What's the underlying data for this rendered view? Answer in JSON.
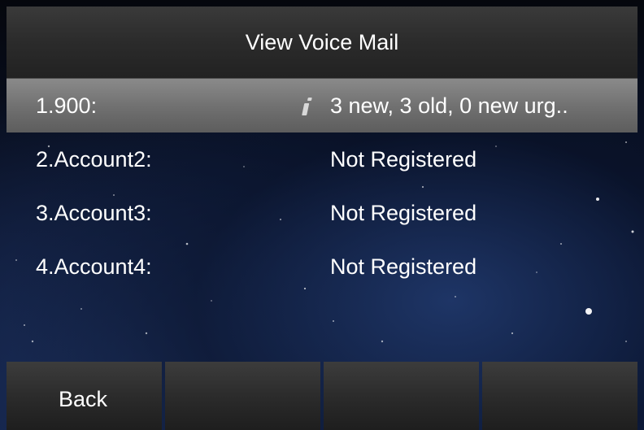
{
  "header": {
    "title": "View Voice Mail"
  },
  "accounts": [
    {
      "label": "1.900:",
      "status": "3 new, 3 old, 0 new urg..",
      "info_icon": "info-icon"
    },
    {
      "label": "2.Account2:",
      "status": "Not Registered"
    },
    {
      "label": "3.Account3:",
      "status": "Not Registered"
    },
    {
      "label": "4.Account4:",
      "status": "Not Registered"
    }
  ],
  "softkeys": [
    "Back",
    "",
    "",
    ""
  ],
  "colors": {
    "selected_row": "#7a7a7a",
    "title_bar": "#2e2e2e",
    "softkey": "#2a2a2a",
    "text": "#ffffff"
  }
}
